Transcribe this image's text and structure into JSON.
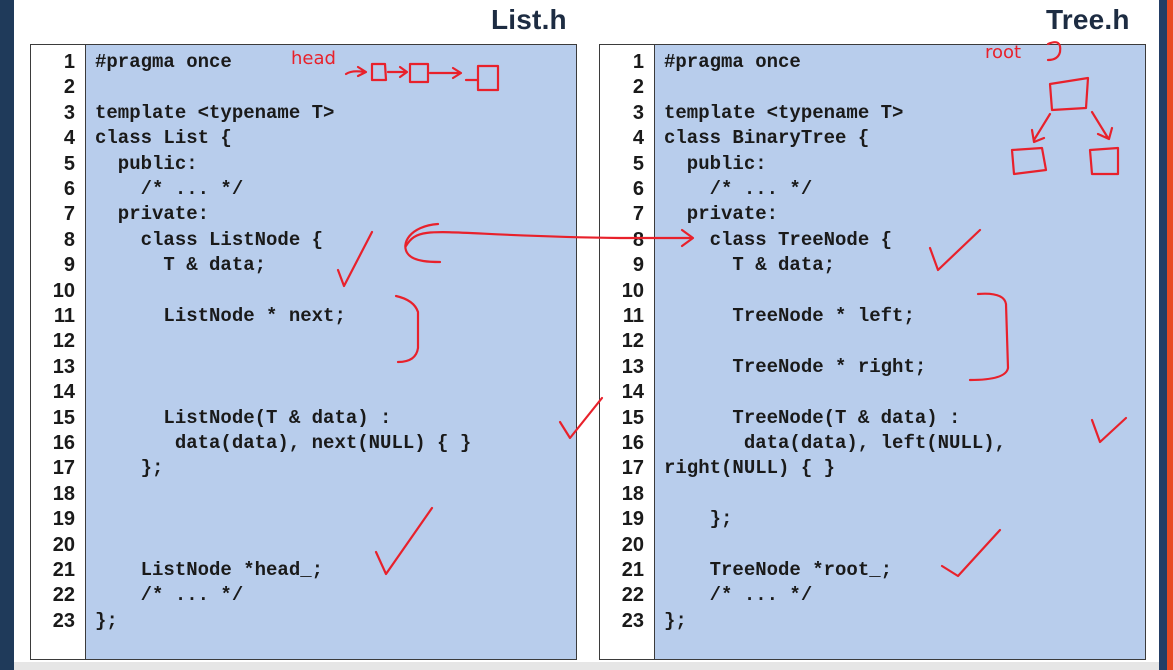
{
  "files": {
    "list": {
      "title": "List.h",
      "lines": [
        "#pragma once",
        "",
        "template <typename T>",
        "class List {",
        "  public:",
        "    /* ... */",
        "  private:",
        "    class ListNode {",
        "      T & data;",
        "",
        "      ListNode * next;",
        "",
        "",
        "",
        "      ListNode(T & data) :",
        "       data(data), next(NULL) { }",
        "    };",
        "",
        "",
        "",
        "    ListNode *head_;",
        "    /* ... */",
        "};"
      ]
    },
    "tree": {
      "title": "Tree.h",
      "lines": [
        "#pragma once",
        "",
        "template <typename T>",
        "class BinaryTree {",
        "  public:",
        "    /* ... */",
        "  private:",
        "    class TreeNode {",
        "      T & data;",
        "",
        "      TreeNode * left;",
        "",
        "      TreeNode * right;",
        "",
        "      TreeNode(T & data) :",
        "       data(data), left(NULL),",
        "right(NULL) { }",
        "",
        "    };",
        "",
        "    TreeNode *root_;",
        "    /* ... */",
        "};"
      ]
    }
  },
  "annotations": {
    "list_note": "head",
    "tree_note": "root",
    "ink_color": "#e8212b"
  },
  "colors": {
    "code_background": "#b8cdec",
    "gutter_background": "#ffffff",
    "title_color": "#1d2c42"
  }
}
